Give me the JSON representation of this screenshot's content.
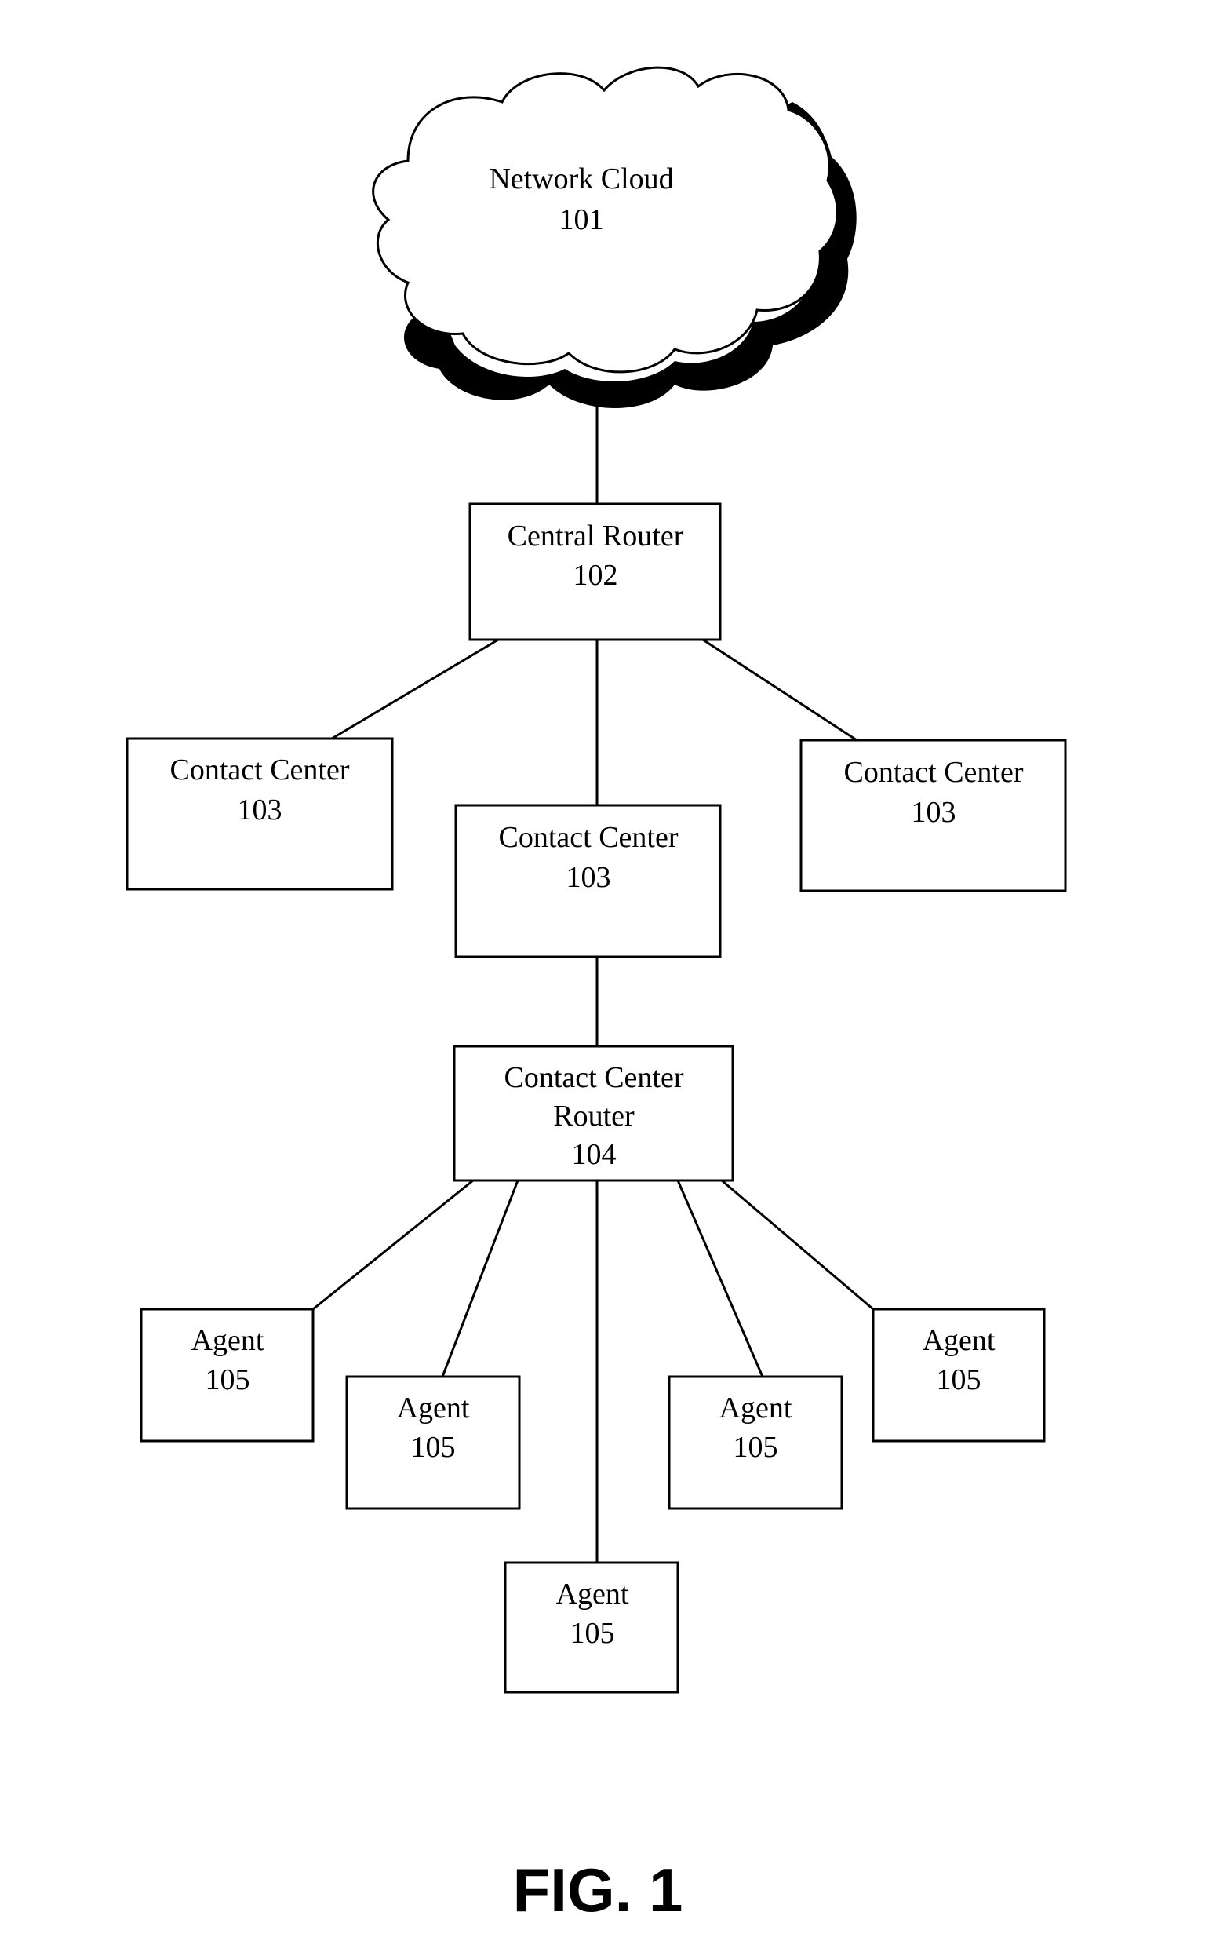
{
  "figure": {
    "label": "FIG. 1"
  },
  "nodes": {
    "cloud": {
      "lines": [
        "Network Cloud",
        "101"
      ]
    },
    "central_router": {
      "lines": [
        "Central Router",
        "102"
      ]
    },
    "contact_center_left": {
      "lines": [
        "Contact Center",
        "103"
      ]
    },
    "contact_center_middle": {
      "lines": [
        "Contact Center",
        "103"
      ]
    },
    "contact_center_right": {
      "lines": [
        "Contact Center",
        "103"
      ]
    },
    "contact_center_router": {
      "lines": [
        "Contact Center",
        "Router",
        "104"
      ]
    },
    "agent_1": {
      "lines": [
        "Agent",
        "105"
      ]
    },
    "agent_2": {
      "lines": [
        "Agent",
        "105"
      ]
    },
    "agent_3": {
      "lines": [
        "Agent",
        "105"
      ]
    },
    "agent_4": {
      "lines": [
        "Agent",
        "105"
      ]
    },
    "agent_5": {
      "lines": [
        "Agent",
        "105"
      ]
    }
  },
  "edges": [
    [
      "cloud",
      "central_router"
    ],
    [
      "central_router",
      "contact_center_left"
    ],
    [
      "central_router",
      "contact_center_middle"
    ],
    [
      "central_router",
      "contact_center_right"
    ],
    [
      "contact_center_middle",
      "contact_center_router"
    ],
    [
      "contact_center_router",
      "agent_1"
    ],
    [
      "contact_center_router",
      "agent_2"
    ],
    [
      "contact_center_router",
      "agent_3"
    ],
    [
      "contact_center_router",
      "agent_4"
    ],
    [
      "contact_center_router",
      "agent_5"
    ]
  ]
}
